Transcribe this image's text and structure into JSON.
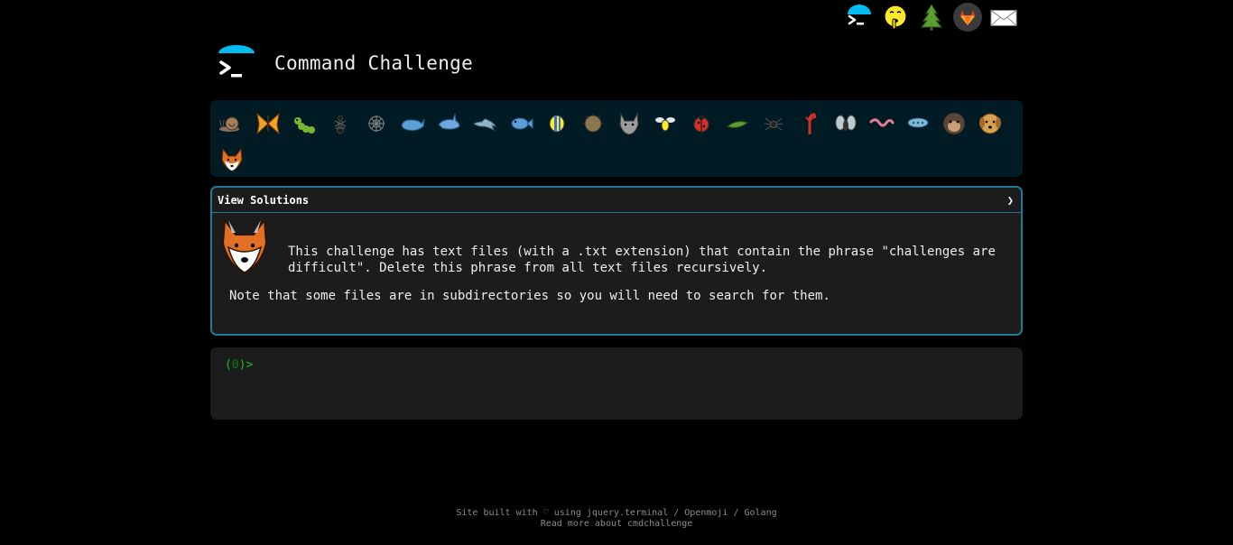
{
  "top_icons": [
    "terminal-icon",
    "shushing-face-icon",
    "tree-icon",
    "gitlab-icon",
    "envelope-icon"
  ],
  "header": {
    "title": "Command Challenge"
  },
  "challenges": [
    "snail",
    "butterfly",
    "caterpillar",
    "ant",
    "spider-web",
    "whale",
    "shark",
    "dolphin",
    "fish",
    "tropical-fish",
    "pufferfish",
    "wolf",
    "bee",
    "ladybug",
    "leafy-bug",
    "spider",
    "scorpion",
    "fly",
    "worm",
    "microbe",
    "gorilla",
    "dog",
    "fox"
  ],
  "panel": {
    "heading": "View Solutions",
    "toggle": "❯",
    "description": "This challenge has text files (with a .txt extension) that contain the phrase \"challenges are difficult\". Delete this phrase from all text files recursively.",
    "note": "Note that some files are in subdirectories so you will need to search for them."
  },
  "terminal": {
    "open": "(",
    "num": "0",
    "close": ")",
    "gt": ">"
  },
  "footer": {
    "line1_prefix": "Site built with ",
    "heart": "♡",
    "line1_mid": " using ",
    "link_jquery": "jquery.terminal",
    "sep1": " / ",
    "link_openmoji": "Openmoji",
    "sep2": " / ",
    "link_golang": "Golang",
    "line2": "Read more about cmdchallenge"
  },
  "colors": {
    "accent": "#1f7a97",
    "cyan": "#00bcf2",
    "prompt": "#1eba2b"
  }
}
